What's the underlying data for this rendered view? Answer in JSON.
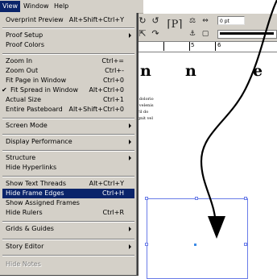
{
  "menubar": {
    "items": [
      {
        "label": "View",
        "active": true
      },
      {
        "label": "Window",
        "active": false
      },
      {
        "label": "Help",
        "active": false
      }
    ]
  },
  "toolbar": {
    "stroke_weight_value": "0 pt",
    "ruler_numbers": [
      "5",
      "6"
    ],
    "icons": [
      "rotate-left-icon",
      "rotate-right-icon",
      "paragraph-p-icon",
      "align-icon",
      "distribute-icon",
      "scale-icon",
      "flip-icon",
      "anchor-icon"
    ]
  },
  "view_menu": {
    "overprint_preview": {
      "label": "Overprint Preview",
      "shortcut": "Alt+Shift+Ctrl+Y"
    },
    "proof_setup": {
      "label": "Proof Setup"
    },
    "proof_colors": {
      "label": "Proof Colors"
    },
    "zoom_in": {
      "label": "Zoom In",
      "shortcut": "Ctrl+="
    },
    "zoom_out": {
      "label": "Zoom Out",
      "shortcut": "Ctrl+-"
    },
    "fit_page": {
      "label": "Fit Page in Window",
      "shortcut": "Ctrl+0"
    },
    "fit_spread": {
      "label": "Fit Spread in Window",
      "shortcut": "Alt+Ctrl+0",
      "checked": true
    },
    "actual_size": {
      "label": "Actual Size",
      "shortcut": "Ctrl+1"
    },
    "entire_pasteboard": {
      "label": "Entire Pasteboard",
      "shortcut": "Alt+Shift+Ctrl+0"
    },
    "screen_mode": {
      "label": "Screen Mode"
    },
    "display_performance": {
      "label": "Display Performance"
    },
    "structure": {
      "label": "Structure"
    },
    "hide_hyperlinks": {
      "label": "Hide Hyperlinks"
    },
    "show_text_threads": {
      "label": "Show Text Threads",
      "shortcut": "Alt+Ctrl+Y"
    },
    "hide_frame_edges": {
      "label": "Hide Frame Edges",
      "shortcut": "Ctrl+H",
      "highlighted": true
    },
    "show_assigned_frames": {
      "label": "Show Assigned Frames"
    },
    "hide_rulers": {
      "label": "Hide Rulers",
      "shortcut": "Ctrl+R"
    },
    "grids_guides": {
      "label": "Grids & Guides"
    },
    "story_editor": {
      "label": "Story Editor"
    },
    "hide_notes": {
      "label": "Hide Notes",
      "disabled": true
    }
  },
  "document": {
    "heading_letters": [
      "n",
      "n",
      "e"
    ],
    "body_lines": [
      "n dolorio",
      "h velenis",
      "xril do",
      "agnit vel"
    ]
  },
  "colors": {
    "menu_bg": "#d4d0c8",
    "highlight": "#0a246a",
    "frame_edge": "#6a7ce8"
  }
}
